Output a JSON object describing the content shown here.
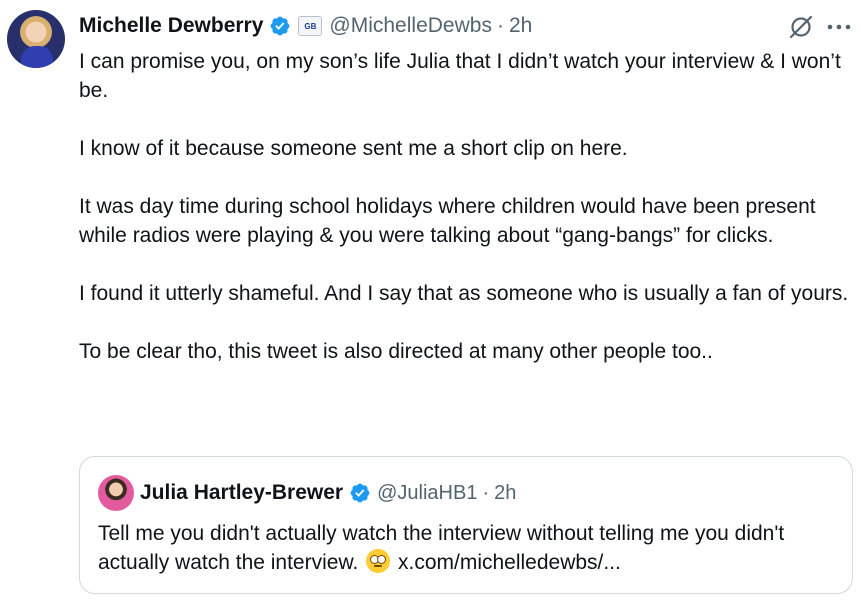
{
  "tweet": {
    "author_name": "Michelle Dewberry",
    "affiliation_badge": "GB",
    "handle": "@MichelleDewbs",
    "separator": "·",
    "time": "2h",
    "paragraphs": [
      "I can promise you, on my son’s life Julia that I didn’t watch your interview & I won’t be.",
      "I know of it because someone sent me a short clip on here.",
      "It was day time during school holidays where children would have been present while radios were playing & you were talking about “gang-bangs” for clicks.",
      "I found it utterly shameful. And I say that as someone who is usually a fan of yours.",
      "To be clear tho, this tweet is also directed at many other people too.."
    ]
  },
  "quoted_tweet": {
    "author_name": "Julia Hartley-Brewer",
    "handle": "@JuliaHB1",
    "separator": "·",
    "time": "2h",
    "text": "Tell me you didn't actually watch the interview without telling me you didn't actually watch the interview.",
    "emoji": "face-with-rolling-eyes",
    "link": "x.com/michelledewbs/..."
  },
  "icons": {
    "verified": "verified-badge-icon",
    "grok": "grok-icon",
    "more": "more-icon"
  },
  "colors": {
    "verified_blue": "#1d9bf0",
    "secondary_text": "#536471",
    "border": "#cfd9de"
  }
}
